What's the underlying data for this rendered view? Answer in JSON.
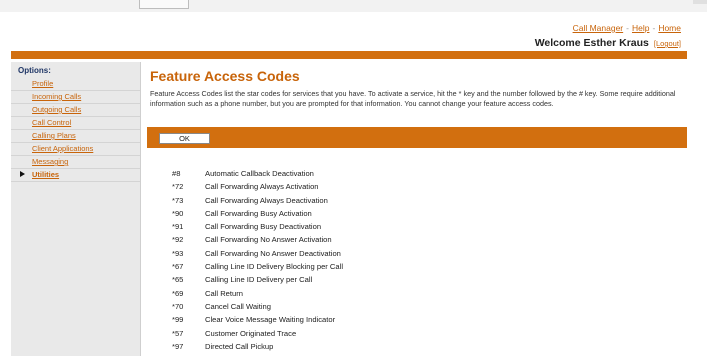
{
  "header": {
    "links": [
      "Call Manager",
      "Help",
      "Home"
    ],
    "link_separator": "-",
    "welcome": "Welcome Esther Kraus",
    "logout": "[Logout]"
  },
  "sidebar": {
    "heading": "Options:",
    "items": [
      {
        "label": "Profile"
      },
      {
        "label": "Incoming Calls"
      },
      {
        "label": "Outgoing Calls"
      },
      {
        "label": "Call Control"
      },
      {
        "label": "Calling Plans"
      },
      {
        "label": "Client Applications"
      },
      {
        "label": "Messaging"
      },
      {
        "label": "Utilities",
        "active": true
      }
    ]
  },
  "main": {
    "title": "Feature Access Codes",
    "description": "Feature Access Codes list the star codes for services that you have. To activate a service, hit the * key and the number followed by the # key. Some require additional information such as a phone number, but you are prompted for that information. You cannot change your feature access codes.",
    "ok_label": "OK",
    "codes": [
      {
        "code": "#8",
        "name": "Automatic Callback Deactivation"
      },
      {
        "code": "*72",
        "name": "Call Forwarding Always Activation"
      },
      {
        "code": "*73",
        "name": "Call Forwarding Always Deactivation"
      },
      {
        "code": "*90",
        "name": "Call Forwarding Busy Activation"
      },
      {
        "code": "*91",
        "name": "Call Forwarding Busy Deactivation"
      },
      {
        "code": "*92",
        "name": "Call Forwarding No Answer Activation"
      },
      {
        "code": "*93",
        "name": "Call Forwarding No Answer Deactivation"
      },
      {
        "code": "*67",
        "name": "Calling Line ID Delivery Blocking per Call"
      },
      {
        "code": "*65",
        "name": "Calling Line ID Delivery per Call"
      },
      {
        "code": "*69",
        "name": "Call Return"
      },
      {
        "code": "*70",
        "name": "Cancel Call Waiting"
      },
      {
        "code": "*99",
        "name": "Clear Voice Message Waiting Indicator"
      },
      {
        "code": "*57",
        "name": "Customer Originated Trace"
      },
      {
        "code": "*97",
        "name": "Directed Call Pickup"
      }
    ]
  },
  "colors": {
    "accent": "#d26f0f",
    "link": "#c8640a",
    "sidebar_heading": "#1f3666"
  }
}
